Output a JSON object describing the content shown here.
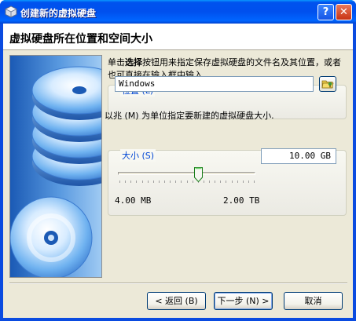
{
  "window": {
    "title": "创建新的虚拟硬盘",
    "help_label": "?",
    "close_label": "✕"
  },
  "header": {
    "title": "虚拟硬盘所在位置和空间大小"
  },
  "description": {
    "prefix": "单击",
    "bold": "选择",
    "suffix": "按钮用来指定保存虚拟硬盘的文件名及其位置，或者也可直接在输入框中输入."
  },
  "location": {
    "group_label": "位置 (L)",
    "value": "Windows"
  },
  "size": {
    "info": "以兆 (M) 为单位指定要新建的虚拟硬盘大小.",
    "group_label": "大小 (S)",
    "value": "10.00 GB",
    "slider_min": "4.00 MB",
    "slider_max": "2.00 TB",
    "slider_fraction": 0.58
  },
  "buttons": {
    "back": "< 返回 (B)",
    "next": "下一步 (N) >",
    "cancel": "取消"
  },
  "colors": {
    "accent": "#0046d5",
    "titlebar": "#0050ee"
  }
}
